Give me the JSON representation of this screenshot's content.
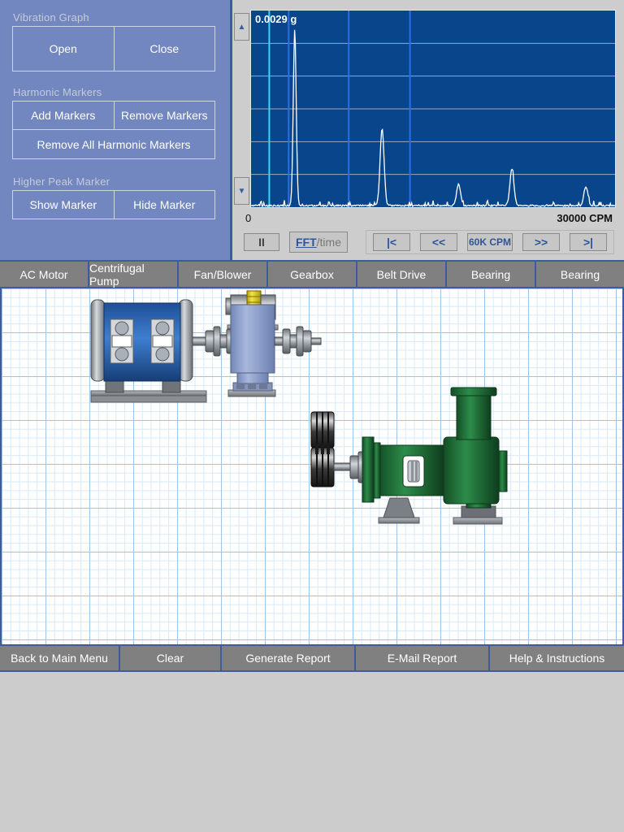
{
  "control_panel": {
    "groups": [
      {
        "label": "Vibration Graph",
        "rows": [
          {
            "buttons": [
              {
                "label": "Open"
              },
              {
                "label": "Close"
              }
            ]
          }
        ]
      },
      {
        "label": "Harmonic Markers",
        "rows": [
          {
            "buttons": [
              {
                "label": "Add Markers"
              },
              {
                "label": "Remove Markers"
              }
            ]
          },
          {
            "buttons": [
              {
                "label": "Remove All  Harmonic Markers"
              }
            ]
          }
        ]
      },
      {
        "label": "Higher Peak Marker",
        "rows": [
          {
            "buttons": [
              {
                "label": "Show Marker"
              },
              {
                "label": "Hide Marker"
              }
            ]
          }
        ]
      }
    ]
  },
  "graph": {
    "amplitude_label": "0.0029 g",
    "axis_min_label": "0",
    "axis_max_label": "30000 CPM",
    "scroll_up_icon": "▲",
    "scroll_down_icon": "▼",
    "colors": {
      "plot_background": "#08458b",
      "trace": "#ffffff",
      "horizontal_gridline": "#9aa8bd",
      "cursor_line": "#35d6f0",
      "marker_line": "#2b6fe0",
      "panel_background": "#cdcdcd"
    }
  },
  "transport": {
    "pause_label": "II",
    "fft_active_label": "FFT",
    "fft_inactive_label": "/time",
    "nav": [
      {
        "label": "|<",
        "name": "first"
      },
      {
        "label": "<<",
        "name": "previous"
      },
      {
        "label": "60K CPM",
        "name": "span"
      },
      {
        "label": ">>",
        "name": "next"
      },
      {
        "label": ">|",
        "name": "last"
      }
    ]
  },
  "tabs": [
    {
      "label": "AC Motor"
    },
    {
      "label": "Centrifugal Pump"
    },
    {
      "label": "Fan/Blower"
    },
    {
      "label": "Gearbox"
    },
    {
      "label": "Belt Drive"
    },
    {
      "label": "Bearing"
    },
    {
      "label": "Bearing"
    }
  ],
  "bottom_bar": [
    {
      "label": "Back to Main Menu",
      "width": 148
    },
    {
      "label": "Clear",
      "width": 125
    },
    {
      "label": "Generate Report",
      "width": 165
    },
    {
      "label": "E-Mail Report",
      "width": 165
    },
    {
      "label": "Help & Instructions",
      "width": 165
    }
  ],
  "machine_train": {
    "components": [
      {
        "name": "fan-blower",
        "color": "#e8d434"
      },
      {
        "name": "ac-motor",
        "color": "#2a5fa8"
      },
      {
        "name": "gearbox",
        "color": "#8ba0cc"
      },
      {
        "name": "belt-drive",
        "color": "#2a2a2a"
      },
      {
        "name": "centrifugal-pump",
        "color": "#1d6b34"
      }
    ]
  },
  "chart_data": {
    "type": "line",
    "title": "Vibration FFT Spectrum",
    "xlabel": "CPM",
    "ylabel": "g",
    "xlim": [
      0,
      30000
    ],
    "ylim": [
      0,
      0.0029
    ],
    "grid": true,
    "legend": "none",
    "peaks": [
      {
        "x": 3600,
        "amplitude": 0.00265
      },
      {
        "x": 10800,
        "amplitude": 0.00115
      },
      {
        "x": 17100,
        "amplitude": 0.00032
      },
      {
        "x": 21500,
        "amplitude": 0.00055
      },
      {
        "x": 27600,
        "amplitude": 0.00028
      }
    ],
    "cursor_lines_cpm": [
      1500
    ],
    "marker_lines_cpm": [
      3100,
      8050,
      13100
    ],
    "y_gridlines": 5
  }
}
